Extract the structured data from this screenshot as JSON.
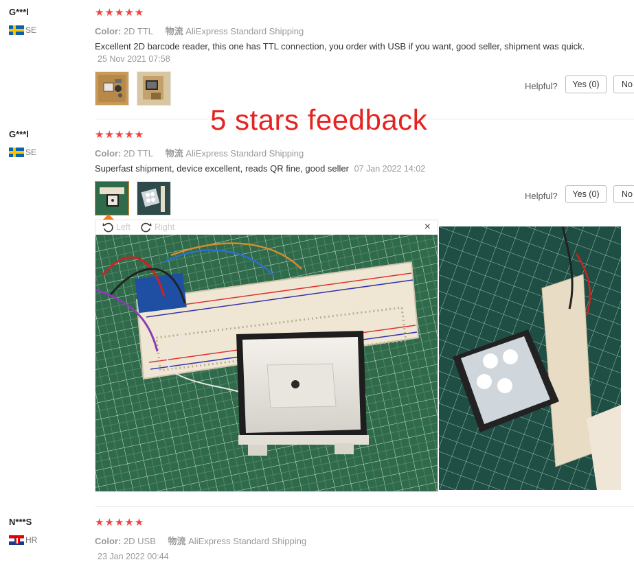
{
  "overlay_note": "5 stars feedback",
  "reviews": [
    {
      "user": "G***l",
      "country": "SE",
      "stars": "★★★★★",
      "color_label": "Color:",
      "color_value": "2D TTL",
      "shipping_label": "物流",
      "shipping_value": "AliExpress Standard Shipping",
      "text": "Excellent 2D barcode reader, this one has TTL connection, you order with USB if you want, good seller, shipment was quick.",
      "date": "25 Nov 2021 07:58",
      "helpful_label": "Helpful?",
      "yes_label": "Yes (0)",
      "no_label": "No"
    },
    {
      "user": "G***l",
      "country": "SE",
      "stars": "★★★★★",
      "color_label": "Color:",
      "color_value": "2D TTL",
      "shipping_label": "物流",
      "shipping_value": "AliExpress Standard Shipping",
      "text": "Superfast shipment, device excellent, reads QR fine, good seller",
      "date": "07 Jan 2022 14:02",
      "helpful_label": "Helpful?",
      "yes_label": "Yes (0)",
      "no_label": "No",
      "viewer": {
        "rotate_left_label": "Left",
        "rotate_right_label": "Right",
        "close_glyph": "×"
      }
    },
    {
      "user": "N***S",
      "country": "HR",
      "stars": "★★★★★",
      "color_label": "Color:",
      "color_value": "2D USB",
      "shipping_label": "物流",
      "shipping_value": "AliExpress Standard Shipping",
      "date": "23 Jan 2022 00:44"
    }
  ],
  "colors": {
    "star": "#f24141",
    "overlay_note": "#e52421",
    "active_thumb_border": "#f07c1c",
    "cutting_mat": "#2f6b4a"
  },
  "icons": [
    "star-icon",
    "flag-se-icon",
    "flag-hr-icon",
    "rotate-left-icon",
    "rotate-right-icon",
    "close-icon"
  ]
}
